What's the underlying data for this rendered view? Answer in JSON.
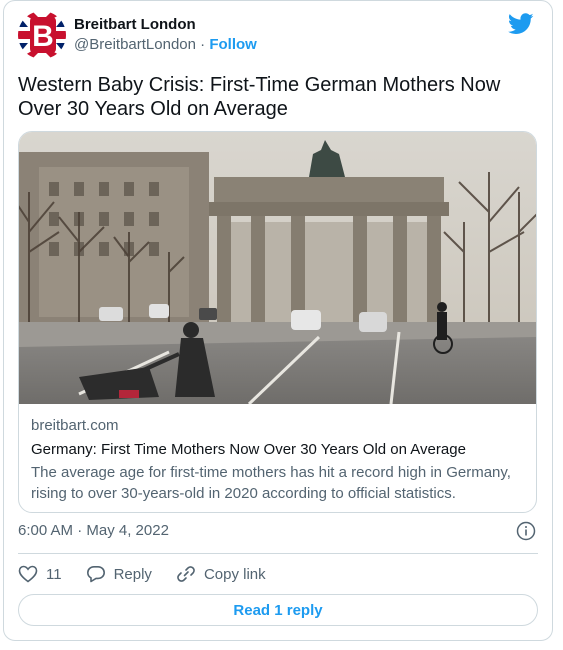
{
  "account": {
    "display_name": "Breitbart London",
    "handle": "@BreitbartLondon",
    "separator": "·",
    "follow_label": "Follow",
    "avatar_letter": "B"
  },
  "tweet": {
    "text": "Western Baby Crisis: First-Time German Mothers Now Over 30 Years Old on Average",
    "timestamp": "6:00 AM · May 4, 2022"
  },
  "link_card": {
    "domain": "breitbart.com",
    "title": "Germany: First Time Mothers Now Over 30 Years Old on Average",
    "description": "The average age for first-time mothers has hit a record high in Germany, rising to over 30-years-old in 2020 according to official statistics."
  },
  "actions": {
    "like_count": "11",
    "reply_label": "Reply",
    "copy_link_label": "Copy link",
    "read_reply_label": "Read 1 reply"
  },
  "colors": {
    "twitter_blue": "#1d9bf0",
    "text_primary": "#0f1419",
    "text_secondary": "#536471",
    "border": "#cfd9de"
  }
}
